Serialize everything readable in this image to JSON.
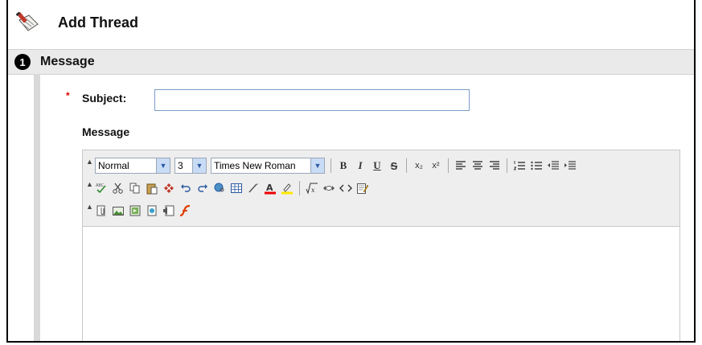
{
  "header": {
    "title": "Add Thread",
    "icon": "notepad-pen-icon"
  },
  "section": {
    "step": "1",
    "title": "Message"
  },
  "form": {
    "required_marker": "*",
    "subject_label": "Subject:",
    "subject_value": "",
    "message_label": "Message"
  },
  "toolbar": {
    "style_select": "Normal",
    "size_select": "3",
    "font_select": "Times New Roman",
    "bold": "B",
    "italic": "I",
    "underline": "U",
    "strike": "S",
    "subscript": "x₂",
    "superscript": "x²"
  },
  "colors": {
    "accent_blue": "#2c5aa0",
    "required_red": "#dd0000",
    "section_bg": "#eaeaea"
  }
}
